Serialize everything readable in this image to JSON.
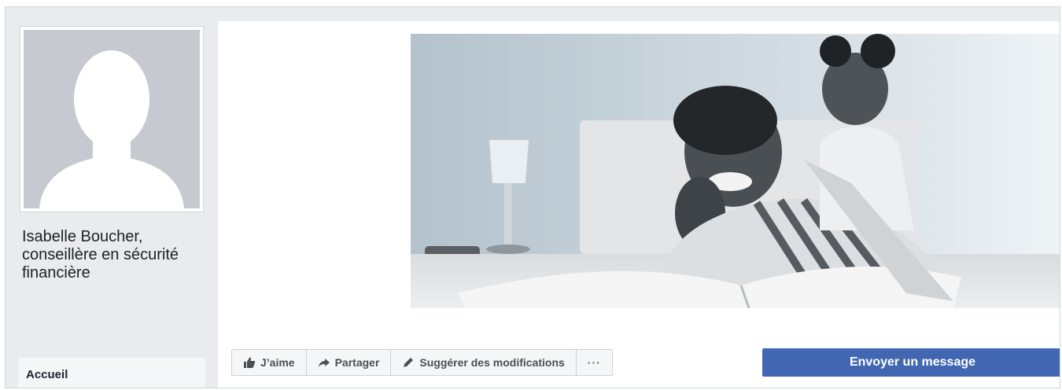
{
  "page": {
    "name": "Isabelle Boucher, conseillère en sécurité financière"
  },
  "left_nav": {
    "items": [
      {
        "label": "Accueil"
      }
    ]
  },
  "actions": {
    "like_label": "J’aime",
    "share_label": "Partager",
    "suggest_label": "Suggérer des modifications",
    "more_label": "···",
    "message_label": "Envoyer un message"
  },
  "icons": {
    "like": "thumbs-up-icon",
    "share": "share-arrow-icon",
    "suggest": "pencil-icon",
    "more": "ellipsis-icon"
  },
  "colors": {
    "background": "#e9ebee",
    "primary_button": "#4267b2",
    "button_text": "#4b4f56"
  }
}
